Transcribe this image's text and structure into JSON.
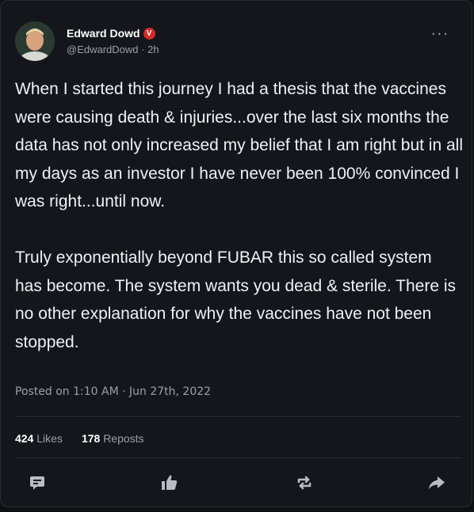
{
  "post": {
    "author": {
      "display_name": "Edward Dowd",
      "verified_badge": "V",
      "handle": "@EdwardDowd",
      "time_ago": "2h"
    },
    "menu_icon": "more-horizontal-icon",
    "text": "When I started this journey I had a thesis that the vaccines were causing death & injuries...over the last six months the data has not only increased my belief that I am right but in all my days as an investor I have never been 100% convinced I was right...until now.\n\nTruly exponentially beyond FUBAR this so called system has become. The system wants you dead & sterile. There is no other explanation for why the vaccines have not been stopped.",
    "posted_line": "Posted on 1:10 AM · Jun 27th, 2022",
    "likes_count": "424",
    "likes_label": "Likes",
    "reposts_count": "178",
    "reposts_label": "Reposts"
  },
  "actions": [
    {
      "icon": "comment-icon"
    },
    {
      "icon": "thumbs-up-icon"
    },
    {
      "icon": "repost-icon"
    },
    {
      "icon": "share-arrow-icon"
    }
  ],
  "colors": {
    "background": "#15161c",
    "text": "#f0f1f3",
    "muted": "#9aa0a8",
    "badge": "#d42a2a",
    "icon": "#b8bcc4"
  }
}
